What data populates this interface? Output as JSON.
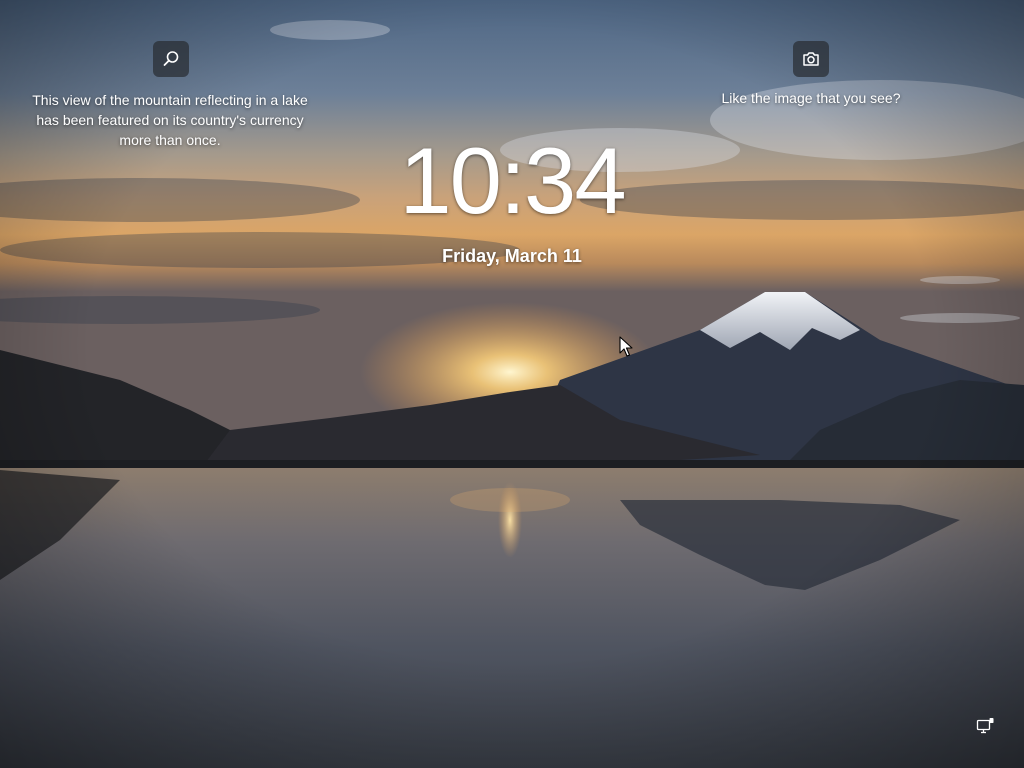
{
  "background": {
    "scene": "mountain reflecting in lake at sunrise",
    "colors": {
      "sky_top": "#4e6684",
      "horizon": "#e8a24e",
      "sun": "#fff4c8",
      "water": "#5d6069"
    }
  },
  "spotlight": {
    "search_icon": "search-icon",
    "fact_text": "This view of the mountain reflecting in a lake has been featured on its country's currency more than once.",
    "camera_icon": "camera-icon",
    "like_text": "Like the image that you see?"
  },
  "clock": {
    "time": "10:34",
    "date": "Friday, March 11"
  },
  "tray": {
    "network_icon": "network-monitor-icon"
  }
}
